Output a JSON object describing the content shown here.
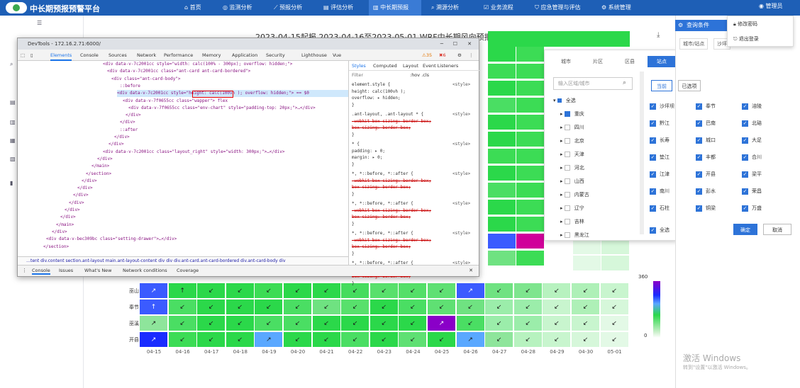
{
  "app": {
    "title": "中长期预报预警平台",
    "user": "管理员"
  },
  "nav": [
    {
      "icon": "home-icon",
      "label": "首页"
    },
    {
      "icon": "monitor-icon",
      "label": "监测分析"
    },
    {
      "icon": "trend-icon",
      "label": "预报分析"
    },
    {
      "icon": "assess-icon",
      "label": "评估分析"
    },
    {
      "icon": "forecast-icon",
      "label": "中长期预报",
      "active": true
    },
    {
      "icon": "trace-icon",
      "label": "溯源分析"
    },
    {
      "icon": "flow-icon",
      "label": "业务流程"
    },
    {
      "icon": "emergency-icon",
      "label": "应急管理与评估"
    },
    {
      "icon": "settings-icon",
      "label": "系统管理"
    }
  ],
  "chart": {
    "title": "2023-04-15起报 2023-04-16至2023-05-01 WRF中长期风向预报（°）"
  },
  "chart_data": {
    "type": "heatmap",
    "rows": [
      "巫山",
      "奉节",
      "巫溪",
      "开县"
    ],
    "x": [
      "04-15",
      "04-16",
      "04-17",
      "04-18",
      "04-19",
      "04-20",
      "04-21",
      "04-22",
      "04-23",
      "04-24",
      "04-25",
      "04-26",
      "04-27",
      "04-28",
      "04-29",
      "04-30",
      "05-01"
    ],
    "legend": {
      "max": "360",
      "min": "0"
    },
    "cells": [
      [
        {
          "c": "#3b5bff",
          "a": "↗"
        },
        {
          "c": "#2bd84a",
          "a": "↑"
        },
        {
          "c": "#2bd84a",
          "a": "↙"
        },
        {
          "c": "#2bd84a",
          "a": "↙"
        },
        {
          "c": "#3cdc55",
          "a": "↙"
        },
        {
          "c": "#2bd84a",
          "a": "↙"
        },
        {
          "c": "#2bd84a",
          "a": "↙"
        },
        {
          "c": "#45dc5e",
          "a": "↙"
        },
        {
          "c": "#58e06c",
          "a": "↙"
        },
        {
          "c": "#54df68",
          "a": "↙"
        },
        {
          "c": "#5fe073",
          "a": "↙"
        },
        {
          "c": "#3b5bff",
          "a": "↗"
        },
        {
          "c": "#6fe281",
          "a": "↙"
        },
        {
          "c": "#7ee58e",
          "a": "↙"
        },
        {
          "c": "#b7f2bf",
          "a": "↙"
        },
        {
          "c": "#aef0b7",
          "a": "↙"
        },
        {
          "c": "#c8f5ce",
          "a": "↙"
        }
      ],
      [
        {
          "c": "#3b5bff",
          "a": "↑"
        },
        {
          "c": "#4ade63",
          "a": "↙"
        },
        {
          "c": "#2bd84a",
          "a": "↙"
        },
        {
          "c": "#2bd84a",
          "a": "↙"
        },
        {
          "c": "#2bd84a",
          "a": "↙"
        },
        {
          "c": "#4ade63",
          "a": "↙"
        },
        {
          "c": "#6fe281",
          "a": "↙"
        },
        {
          "c": "#58e06c",
          "a": "↙"
        },
        {
          "c": "#2bd84a",
          "a": "↙"
        },
        {
          "c": "#4ade63",
          "a": "↙"
        },
        {
          "c": "#5fe073",
          "a": "↙"
        },
        {
          "c": "#6fe281",
          "a": "↙"
        },
        {
          "c": "#9bedaa",
          "a": "↙"
        },
        {
          "c": "#9bedaa",
          "a": "↙"
        },
        {
          "c": "#c8f5ce",
          "a": "↙"
        },
        {
          "c": "#aef0b7",
          "a": "↙"
        },
        {
          "c": "#d6f7da",
          "a": "↙"
        }
      ],
      [
        {
          "c": "#8ee59b",
          "a": "↗"
        },
        {
          "c": "#4ade63",
          "a": "↙"
        },
        {
          "c": "#2bd84a",
          "a": "↙"
        },
        {
          "c": "#2bd84a",
          "a": "↙"
        },
        {
          "c": "#4ade63",
          "a": "↙"
        },
        {
          "c": "#4ade63",
          "a": "↙"
        },
        {
          "c": "#2bd84a",
          "a": "↙"
        },
        {
          "c": "#2bd84a",
          "a": "↙"
        },
        {
          "c": "#2bd84a",
          "a": "↙"
        },
        {
          "c": "#2bd84a",
          "a": "↙"
        },
        {
          "c": "#8a00c8",
          "a": "↗"
        },
        {
          "c": "#4ade63",
          "a": "↙"
        },
        {
          "c": "#9bedaa",
          "a": "↙"
        },
        {
          "c": "#9bedaa",
          "a": "↙"
        },
        {
          "c": "#c8f5ce",
          "a": "↙"
        },
        {
          "c": "#c8f5ce",
          "a": "↙"
        },
        {
          "c": "#e3f9e6",
          "a": "↙"
        }
      ],
      [
        {
          "c": "#1a2cff",
          "a": "↗"
        },
        {
          "c": "#3cdc55",
          "a": "↙"
        },
        {
          "c": "#2bd84a",
          "a": "↙"
        },
        {
          "c": "#2bd84a",
          "a": "↙"
        },
        {
          "c": "#5aa8ff",
          "a": "↗"
        },
        {
          "c": "#2bd84a",
          "a": "↙"
        },
        {
          "c": "#2bd84a",
          "a": "↙"
        },
        {
          "c": "#4ade63",
          "a": "↙"
        },
        {
          "c": "#2bd84a",
          "a": "↙"
        },
        {
          "c": "#5fe073",
          "a": "↙"
        },
        {
          "c": "#2bd84a",
          "a": "↙"
        },
        {
          "c": "#5aa8ff",
          "a": "↗"
        },
        {
          "c": "#8ee59b",
          "a": "↙"
        },
        {
          "c": "#b7f2bf",
          "a": "↙"
        },
        {
          "c": "#c8f5ce",
          "a": "↙"
        },
        {
          "c": "#d6f7da",
          "a": "↙"
        },
        {
          "c": "#e3f9e6",
          "a": "↙"
        }
      ]
    ]
  },
  "devtools": {
    "title": "DevTools - 172.16.2.71:6000/",
    "tabs": [
      "Elements",
      "Console",
      "Sources",
      "Network",
      "Performance",
      "Memory",
      "Application",
      "Security",
      "Lighthouse",
      "Vue"
    ],
    "warn_count": "35",
    "error_count": "6",
    "code": [
      "<div data-v-7c2001cc style=\"width: calc(100% - 300px); overflow: hidden;\">",
      "<div data-v-7c2001cc class=\"ant-card ant-card-bordered\">",
      "<div class=\"ant-card-body\">",
      "::before",
      "<div data-v-7c2001cc style=\"height: calc(100vh ); overflow: hidden;\"> == $0",
      "<div data-v-7f0655cc class=\"wapper\"> flex",
      "<div data-v-7f0655cc class=\"env-chart\" style=\"padding-top: 20px;\">…</div>",
      "</div>",
      "</div>",
      "::after",
      "</div>",
      "</div>",
      "<div data-v-7c2001cc class=\"layout_right\" style=\"width: 300px;\">…</div>",
      "</div>",
      "</main>",
      "</section>",
      "</div>",
      "</div>",
      "</div>",
      "</div>",
      "</div>",
      "</div>",
      "</main>",
      "</div>",
      "<div data-v-bec309bc class=\"setting-drawer\">…</div>",
      "</section>"
    ],
    "style_tabs": [
      "Styles",
      "Computed",
      "Layout",
      "Event Listeners"
    ],
    "filter": "Filter",
    "filter_hints": ":hov .cls",
    "styles": [
      "element.style {",
      "  height: calc(100vh );",
      "  overflow: ▸ hidden;",
      "}",
      ".ant-layout, .ant-layout * {",
      "  -webkit-box-sizing: border-box;",
      "  box-sizing: border-box;",
      "}",
      "* {",
      "  padding: ▸ 0;",
      "  margin: ▸ 0;",
      "}",
      "*, *::before, *::after {",
      "  -webkit-box-sizing: border-box;",
      "  box-sizing: border-box;",
      "}",
      "*, *::before, *::after {",
      "  -webkit-box-sizing: border-box;",
      "  box-sizing: border-box;",
      "}",
      "*, *::before, *::after {",
      "  -webkit-box-sizing: border-box;",
      "  box-sizing: border-box;",
      "}",
      "*, *::before, *::after {",
      "  -webkit-box-sizing: border-box;",
      "  box-sizing: border-box;",
      "}"
    ],
    "style_source": "<style>",
    "breadcrumbs": "…tent  div.content  section.ant-layout  main.ant-layout-content  div  div  div.ant-card.ant-card-bordered  div.ant-card-body  div",
    "console_tabs": [
      "Console",
      "Issues",
      "What's New",
      "Network conditions",
      "Coverage"
    ]
  },
  "popup": {
    "tabs": [
      "城市",
      "片区",
      "区县",
      "站点"
    ],
    "search_placeholder": "输入区域/城市",
    "tree": [
      {
        "label": "全选",
        "checked": false
      },
      {
        "label": "重庆",
        "checked": true
      },
      {
        "label": "四川",
        "checked": false
      },
      {
        "label": "北京",
        "checked": false
      },
      {
        "label": "天津",
        "checked": false
      },
      {
        "label": "河北",
        "checked": false
      },
      {
        "label": "山西",
        "checked": false
      },
      {
        "label": "内蒙古",
        "checked": false
      },
      {
        "label": "辽宁",
        "checked": false
      },
      {
        "label": "吉林",
        "checked": false
      },
      {
        "label": "黑龙江",
        "checked": false
      }
    ]
  },
  "panel": {
    "header": "查询条件",
    "row_tabs": [
      "城市/站点",
      "沙坪"
    ],
    "btn_current": "当前",
    "btn_selected": "已选项",
    "stations": [
      "沙坪坝",
      "奉节",
      "涪陵",
      "黔江",
      "巴南",
      "北碚",
      "长寿",
      "城口",
      "大足",
      "垫江",
      "丰都",
      "合川",
      "江津",
      "开县",
      "梁平",
      "南川",
      "彭水",
      "荣昌",
      "石柱",
      "铜梁",
      "万盛"
    ],
    "select_all": "全选",
    "confirm": "确定",
    "cancel": "取消"
  },
  "dropdown": {
    "items": [
      "修改密码",
      "退出登录"
    ]
  },
  "watermark": {
    "line1": "激活 Windows",
    "line2": "转到\"设置\"以激活 Windows。"
  }
}
